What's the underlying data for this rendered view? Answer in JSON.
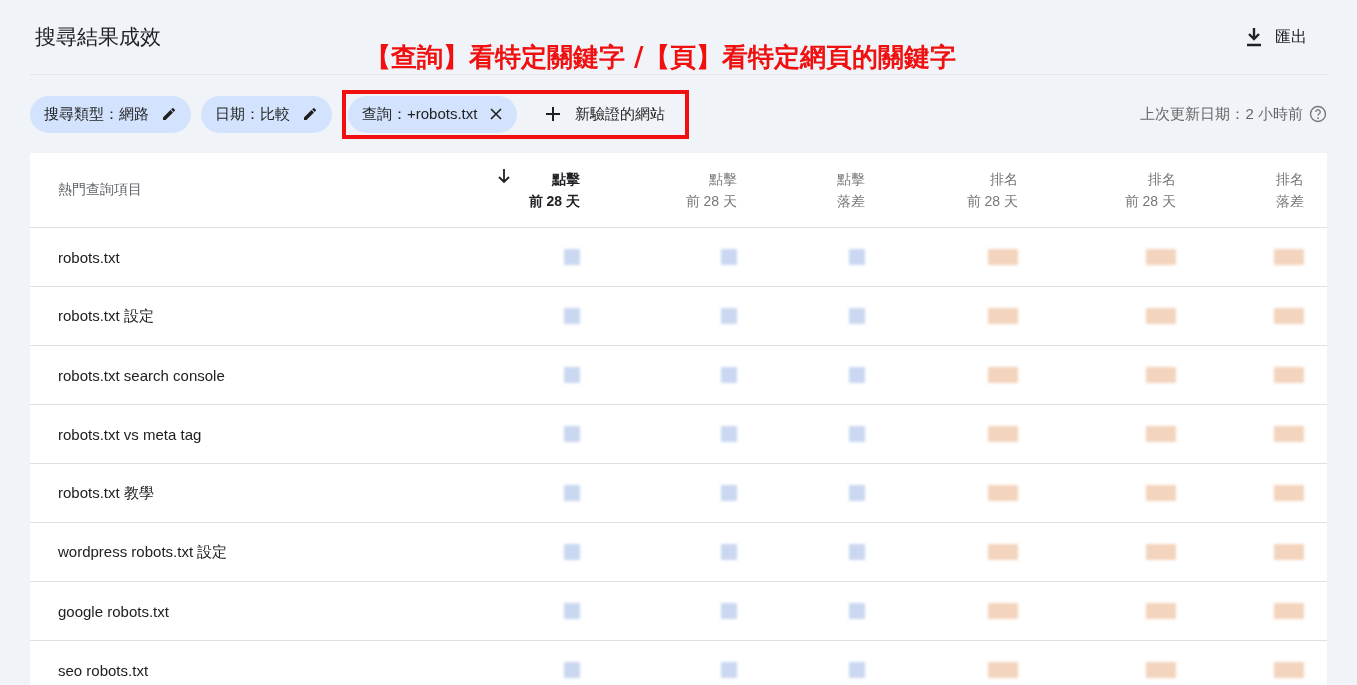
{
  "header": {
    "title": "搜尋結果成效",
    "export_label": "匯出"
  },
  "annotation": "【查詢】看特定關鍵字 /【頁】看特定網頁的關鍵字",
  "filters": [
    {
      "label": "搜尋類型：網路",
      "kind": "edit"
    },
    {
      "label": "日期：比較",
      "kind": "edit"
    },
    {
      "label": "查詢：+robots.txt",
      "kind": "remove"
    }
  ],
  "add_button": "新驗證的網站",
  "last_updated": "上次更新日期：2 小時前",
  "table": {
    "first_column": "熱門查詢項目",
    "columns": [
      {
        "label": "點擊",
        "sub": "前 28 天",
        "kind": "clicks",
        "selected": true
      },
      {
        "label": "點擊",
        "sub": "前 28 天",
        "kind": "clicks",
        "selected": false
      },
      {
        "label": "點擊",
        "sub": "落差",
        "kind": "clicks",
        "selected": false
      },
      {
        "label": "排名",
        "sub": "前 28 天",
        "kind": "position",
        "selected": false
      },
      {
        "label": "排名",
        "sub": "前 28 天",
        "kind": "position",
        "selected": false
      },
      {
        "label": "排名",
        "sub": "落差",
        "kind": "position",
        "selected": false
      }
    ],
    "rows": [
      {
        "query": "robots.txt"
      },
      {
        "query": "robots.txt 設定"
      },
      {
        "query": "robots.txt search console"
      },
      {
        "query": "robots.txt vs meta tag"
      },
      {
        "query": "robots.txt 教學"
      },
      {
        "query": "wordpress robots.txt 設定"
      },
      {
        "query": "google robots.txt"
      },
      {
        "query": "seo robots.txt"
      }
    ]
  }
}
